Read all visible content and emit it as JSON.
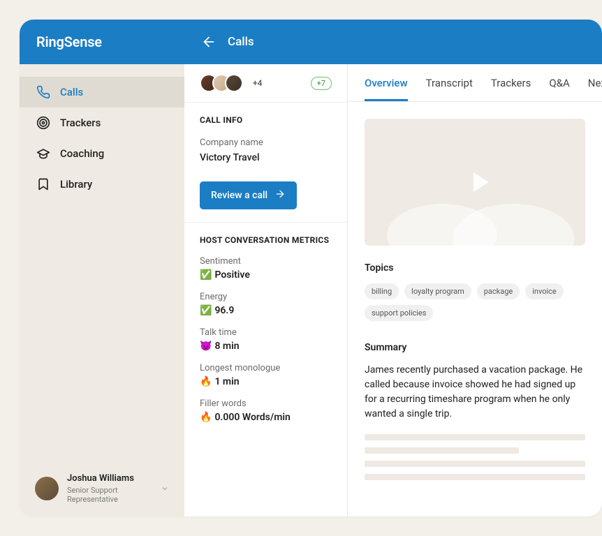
{
  "app": {
    "name": "RingSense"
  },
  "sidebar": {
    "items": [
      {
        "label": "Calls"
      },
      {
        "label": "Trackers"
      },
      {
        "label": "Coaching"
      },
      {
        "label": "Library"
      }
    ]
  },
  "user": {
    "name": "Joshua Williams",
    "role": "Senior Support Representative"
  },
  "header": {
    "title": "Calls"
  },
  "participants": {
    "more_label": "+4",
    "badge_label": "+7"
  },
  "call_info": {
    "section_title": "CALL INFO",
    "company_label": "Company name",
    "company_value": "Victory Travel",
    "review_button": "Review a call"
  },
  "metrics": {
    "section_title": "HOST CONVERSATION METRICS",
    "items": [
      {
        "label": "Sentiment",
        "emoji": "✅",
        "value": "Positive"
      },
      {
        "label": "Energy",
        "emoji": "✅",
        "value": "96.9"
      },
      {
        "label": "Talk time",
        "emoji": "😈",
        "value": "8 min"
      },
      {
        "label": "Longest monologue",
        "emoji": "🔥",
        "value": "1 min"
      },
      {
        "label": "Filler words",
        "emoji": "🔥",
        "value": "0.000 Words/min"
      }
    ]
  },
  "tabs": [
    {
      "label": "Overview"
    },
    {
      "label": "Transcript"
    },
    {
      "label": "Trackers"
    },
    {
      "label": "Q&A"
    },
    {
      "label": "Next st"
    }
  ],
  "topics": {
    "heading": "Topics",
    "chips": [
      "billing",
      "loyalty program",
      "package",
      "invoice",
      "support policies"
    ]
  },
  "summary": {
    "heading": "Summary",
    "text": "James recently purchased a vacation package. He called because invoice showed he had signed up for a recurring timeshare program when he only wanted a single trip."
  }
}
